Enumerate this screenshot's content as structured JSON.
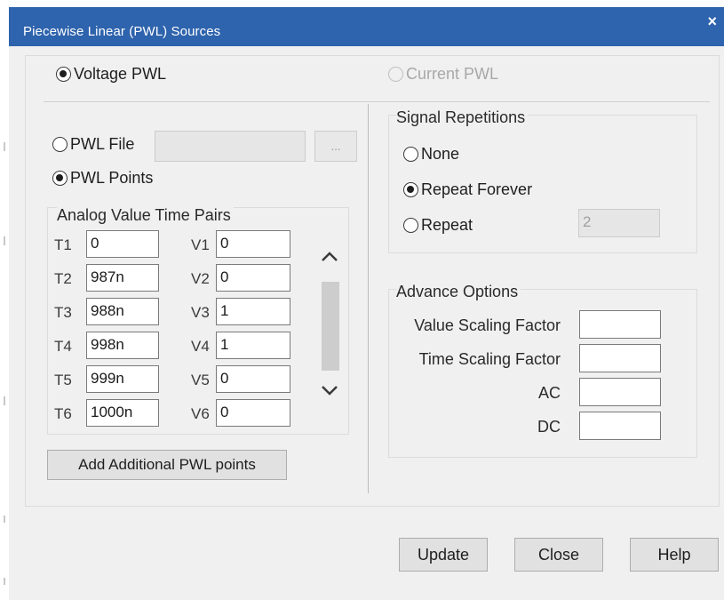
{
  "window": {
    "title": "Piecewise Linear (PWL) Sources",
    "close_glyph": "×"
  },
  "source_type": {
    "voltage_label": "Voltage PWL",
    "current_label": "Current PWL",
    "selected": "voltage"
  },
  "pwl_mode": {
    "file_label": "PWL File",
    "points_label": "PWL Points",
    "browse_label": "...",
    "file_value": "",
    "selected": "points"
  },
  "pairs": {
    "group_label": "Analog Value Time Pairs",
    "rows": [
      {
        "t_label": "T1",
        "t_value": "0",
        "v_label": "V1",
        "v_value": "0"
      },
      {
        "t_label": "T2",
        "t_value": "987n",
        "v_label": "V2",
        "v_value": "0"
      },
      {
        "t_label": "T3",
        "t_value": "988n",
        "v_label": "V3",
        "v_value": "1"
      },
      {
        "t_label": "T4",
        "t_value": "998n",
        "v_label": "V4",
        "v_value": "1"
      },
      {
        "t_label": "T5",
        "t_value": "999n",
        "v_label": "V5",
        "v_value": "0"
      },
      {
        "t_label": "T6",
        "t_value": "1000n",
        "v_label": "V6",
        "v_value": "0"
      }
    ],
    "add_button": "Add Additional PWL points"
  },
  "repetitions": {
    "group_label": "Signal Repetitions",
    "none_label": "None",
    "forever_label": "Repeat Forever",
    "repeat_label": "Repeat",
    "repeat_count": "2",
    "selected": "forever"
  },
  "advance": {
    "group_label": "Advance Options",
    "value_scaling_label": "Value Scaling Factor",
    "time_scaling_label": "Time Scaling Factor",
    "ac_label": "AC",
    "dc_label": "DC",
    "value_scaling": "",
    "time_scaling": "",
    "ac": "",
    "dc": ""
  },
  "footer": {
    "update": "Update",
    "close": "Close",
    "help": "Help"
  },
  "colors": {
    "titlebar": "#2e63ad",
    "dialog_bg": "#f0f0f0"
  }
}
